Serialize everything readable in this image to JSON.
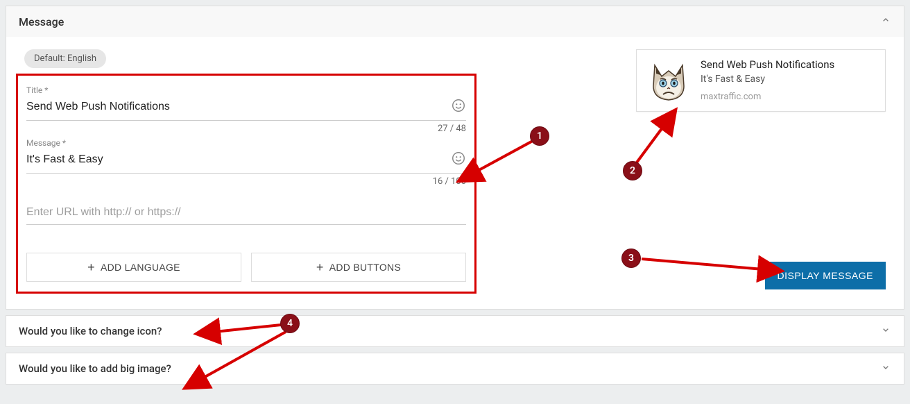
{
  "panel": {
    "title": "Message",
    "lang_chip": "Default: English",
    "title_field": {
      "label": "Title *",
      "value": "Send Web Push Notifications",
      "counter": "27 / 48"
    },
    "message_field": {
      "label": "Message *",
      "value": "It's Fast & Easy",
      "counter": "16 / 100"
    },
    "url_field": {
      "placeholder": "Enter URL with http:// or https://"
    },
    "add_language": "ADD LANGUAGE",
    "add_buttons": "ADD BUTTONS"
  },
  "preview": {
    "title": "Send Web Push Notifications",
    "body": "It's Fast & Easy",
    "domain": "maxtraffic.com"
  },
  "display_button": "DISPLAY MESSAGE",
  "collapsed": {
    "change_icon": "Would you like to change icon?",
    "big_image": "Would you like to add big image?"
  },
  "badges": {
    "1": "1",
    "2": "2",
    "3": "3",
    "4": "4"
  }
}
